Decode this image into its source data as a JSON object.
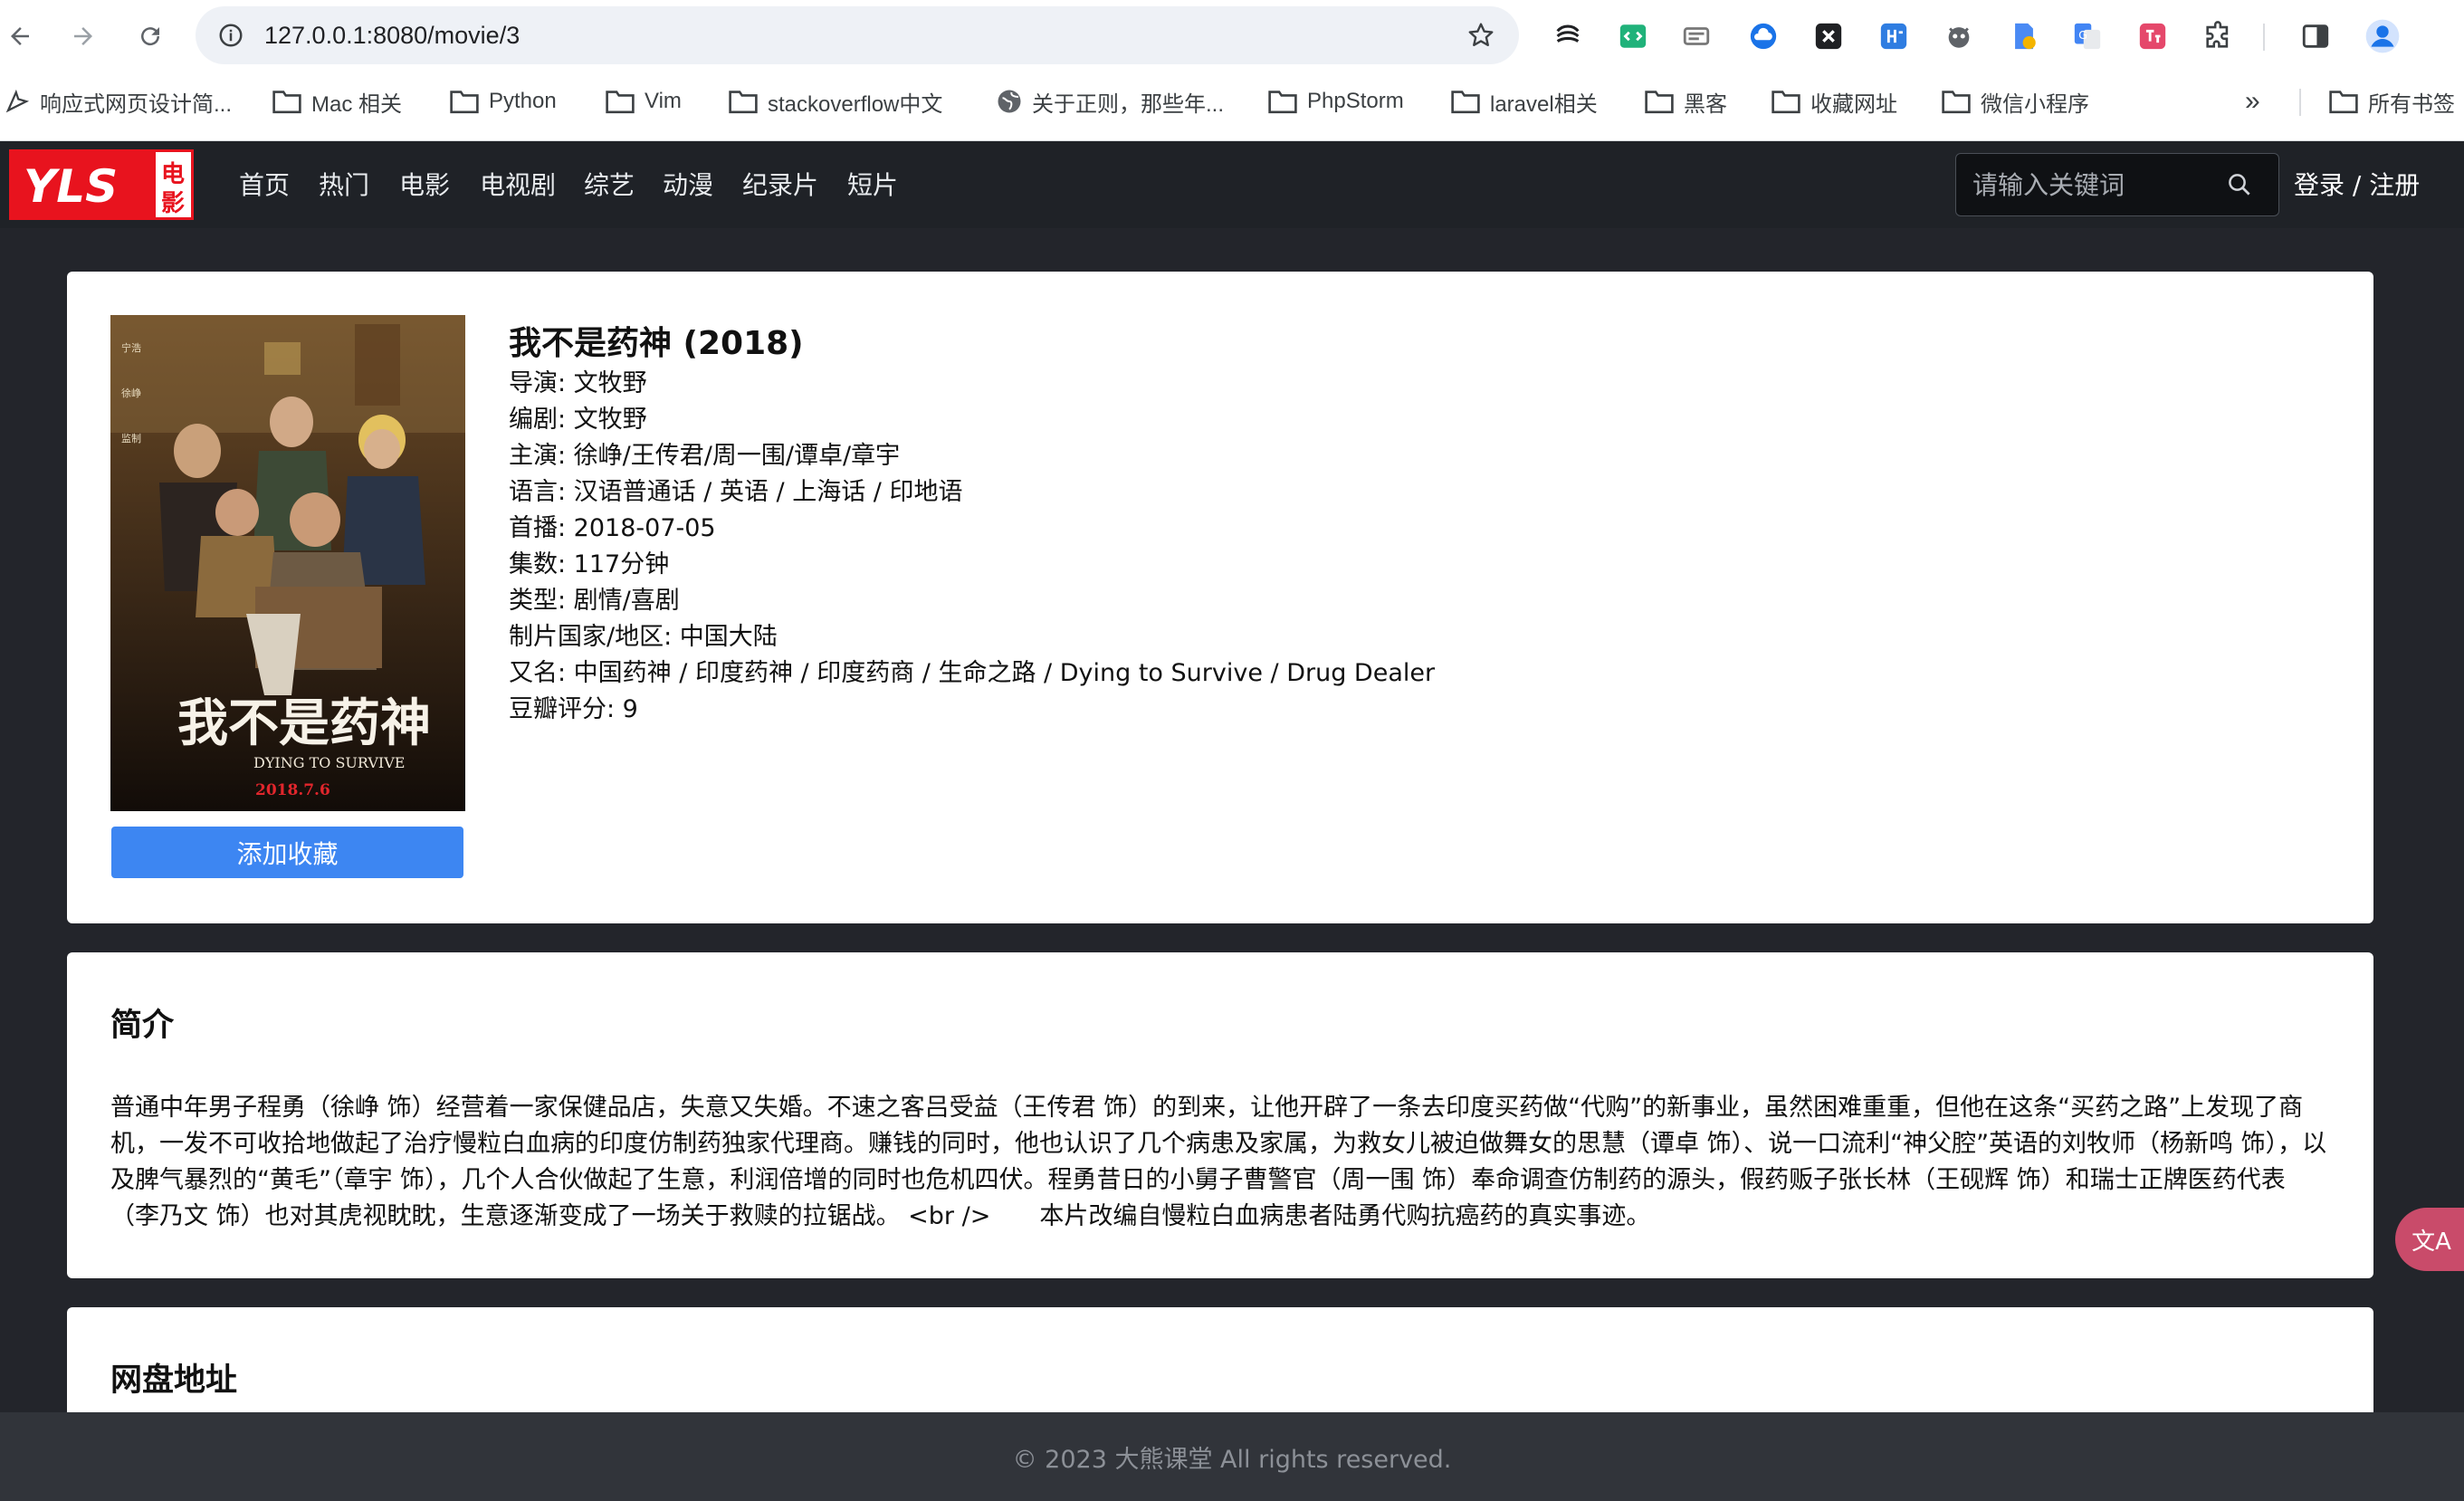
{
  "browser": {
    "url": "127.0.0.1:8080/movie/3",
    "bookmarks": [
      "响应式网页设计简...",
      "Mac 相关",
      "Python",
      "Vim",
      "stackoverflow中文",
      "关于正则，那些年...",
      "PhpStorm",
      "laravel相关",
      "黑客",
      "收藏网址",
      "微信小程序"
    ],
    "more_bookmarks": "»",
    "all_bookmarks": "所有书签"
  },
  "site": {
    "logo_text": "YLS",
    "logo_badge_1": "电",
    "logo_badge_2": "影",
    "nav": [
      "首页",
      "热门",
      "电影",
      "电视剧",
      "综艺",
      "动漫",
      "纪录片",
      "短片"
    ],
    "search_placeholder": "请输入关键词",
    "login": "登录 / 注册",
    "colors": {
      "header_bg": "#1f2227",
      "logo_red": "#e8131e",
      "accent_blue": "#3d86f2"
    }
  },
  "movie": {
    "title": "我不是药神 (2018)",
    "poster_title": "我不是药神",
    "poster_subtitle": "DYING TO SURVIVE",
    "poster_date": "2018.7.6",
    "fav_button": "添加收藏",
    "info": [
      "导演: 文牧野",
      "编剧: 文牧野",
      "主演: 徐峥/王传君/周一围/谭卓/章宇",
      "语言: 汉语普通话 / 英语 / 上海话 / 印地语",
      "首播: 2018-07-05",
      "集数: 117分钟",
      "类型: 剧情/喜剧",
      "制片国家/地区: 中国大陆",
      "又名: 中国药神 / 印度药神 / 印度药商 / 生命之路 / Dying to Survive / Drug Dealer",
      "豆瓣评分: 9"
    ]
  },
  "synopsis": {
    "heading": "简介",
    "text": "普通中年男子程勇（徐峥 饰）经营着一家保健品店，失意又失婚。不速之客吕受益（王传君 饰）的到来，让他开辟了一条去印度买药做“代购”的新事业，虽然困难重重，但他在这条“买药之路”上发现了商机，一发不可收拾地做起了治疗慢粒白血病的印度仿制药独家代理商。赚钱的同时，他也认识了几个病患及家属，为救女儿被迫做舞女的思慧（谭卓 饰）、说一口流利“神父腔”英语的刘牧师（杨新鸣 饰），以及脾气暴烈的“黄毛”（章宇 饰），几个人合伙做起了生意，利润倍增的同时也危机四伏。程勇昔日的小舅子曹警官（周一围 饰）奉命调查仿制药的源头，假药贩子张长林（王砚辉 饰）和瑞士正牌医药代表（李乃文 饰）也对其虎视眈眈，生意逐渐变成了一场关于救赎的拉锯战。 <br />　　本片改编自慢粒白血病患者陆勇代购抗癌药的真实事迹。"
  },
  "netdisk": {
    "heading": "网盘地址"
  },
  "footer": {
    "text": "© 2023 大熊课堂 All rights reserved."
  },
  "translate_fab": "文A"
}
